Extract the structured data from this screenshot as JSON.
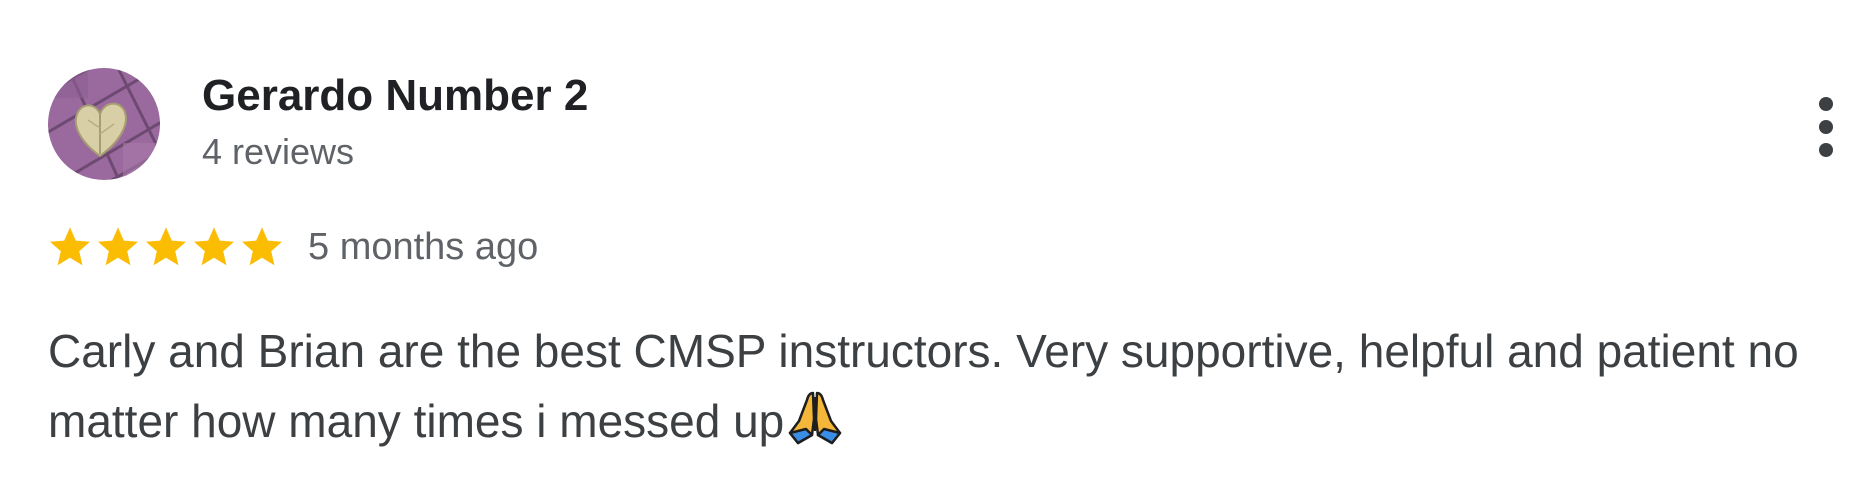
{
  "review": {
    "author_name": "Gerardo Number 2",
    "review_count": "4 reviews",
    "avatar_icon": "avatar-leaf-photo",
    "more_icon": "more-vert-icon",
    "rating": 5,
    "rating_max": 5,
    "date": "5 months ago",
    "text": "Carly and Brian are the best CMSP instructors. Very supportive, helpful and patient no matter how many times i messed up",
    "emoji_icon": "folded-hands-icon"
  },
  "colors": {
    "star": "#fbbc04",
    "name": "#202124",
    "secondary": "#5f6368",
    "body_text": "#3c4043"
  }
}
